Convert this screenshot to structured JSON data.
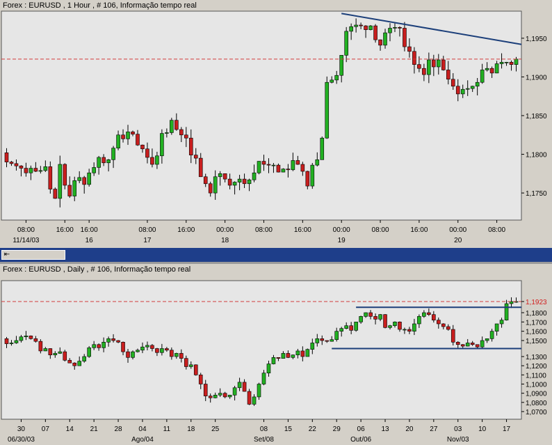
{
  "colors": {
    "background": "#e6e6e6",
    "bull": "#22b022",
    "bear": "#c81e1e",
    "price_line": "#d23c3c",
    "trendline": "#1c3f7a",
    "scrollbar": "#1e3e8a"
  },
  "chart_data": [
    {
      "type": "candlestick",
      "title": "Forex : EURUSD , 1 Hour , # 106, Informação tempo real",
      "current_price": 1.1923,
      "current_price_label": "1,1923",
      "ylim": [
        1.1715,
        1.1985
      ],
      "y_ticks": [
        {
          "value": 1.195,
          "label": "1,1950"
        },
        {
          "value": 1.19,
          "label": "1,1900"
        },
        {
          "value": 1.185,
          "label": "1,1850"
        },
        {
          "value": 1.18,
          "label": "1,1800"
        },
        {
          "value": 1.175,
          "label": "1,1750"
        }
      ],
      "x_count": 106,
      "x_ticks": [
        {
          "index": 4,
          "time": "08:00",
          "date": "11/14/03"
        },
        {
          "index": 12,
          "time": "16:00",
          "date": ""
        },
        {
          "index": 17,
          "time": "16:00",
          "date": "16"
        },
        {
          "index": 29,
          "time": "08:00",
          "date": "17"
        },
        {
          "index": 37,
          "time": "16:00",
          "date": ""
        },
        {
          "index": 45,
          "time": "00:00",
          "date": "18"
        },
        {
          "index": 53,
          "time": "08:00",
          "date": ""
        },
        {
          "index": 61,
          "time": "16:00",
          "date": ""
        },
        {
          "index": 69,
          "time": "00:00",
          "date": "19"
        },
        {
          "index": 77,
          "time": "08:00",
          "date": ""
        },
        {
          "index": 85,
          "time": "16:00",
          "date": ""
        },
        {
          "index": 93,
          "time": "00:00",
          "date": "20"
        },
        {
          "index": 101,
          "time": "08:00",
          "date": ""
        }
      ],
      "close": [
        1.179,
        1.1788,
        1.1785,
        1.1782,
        1.1776,
        1.1782,
        1.1778,
        1.1779,
        1.1784,
        1.1755,
        1.1743,
        1.1787,
        1.176,
        1.1746,
        1.1766,
        1.177,
        1.1761,
        1.1776,
        1.1783,
        1.1796,
        1.1789,
        1.1793,
        1.1808,
        1.1825,
        1.182,
        1.1829,
        1.1826,
        1.1812,
        1.1807,
        1.1796,
        1.1787,
        1.1798,
        1.1827,
        1.1828,
        1.1844,
        1.1832,
        1.1825,
        1.1821,
        1.1799,
        1.1795,
        1.1771,
        1.1762,
        1.175,
        1.1771,
        1.1775,
        1.1768,
        1.176,
        1.1764,
        1.1768,
        1.1762,
        1.1767,
        1.1776,
        1.1791,
        1.1787,
        1.1786,
        1.1786,
        1.1777,
        1.1781,
        1.178,
        1.1792,
        1.1787,
        1.1778,
        1.1759,
        1.1786,
        1.1793,
        1.1821,
        1.1893,
        1.1896,
        1.1902,
        1.1928,
        1.1959,
        1.1965,
        1.1967,
        1.1966,
        1.1961,
        1.1966,
        1.1948,
        1.1941,
        1.1957,
        1.1963,
        1.1964,
        1.1963,
        1.1939,
        1.1933,
        1.1916,
        1.1911,
        1.1903,
        1.1922,
        1.1913,
        1.1922,
        1.1909,
        1.1897,
        1.1888,
        1.1878,
        1.1884,
        1.1885,
        1.1888,
        1.1893,
        1.1909,
        1.1911,
        1.1905,
        1.1917,
        1.1919,
        1.1919,
        1.1916,
        1.1923
      ]
    },
    {
      "type": "candlestick",
      "title": "Forex : EURUSD , Daily , # 106, Informação tempo real",
      "current_price": 1.1923,
      "current_price_label": "1,1923",
      "y_ticks": [
        {
          "value": 1.1923,
          "label": "1,1923"
        },
        {
          "value": 1.18,
          "label": "1,1800"
        },
        {
          "value": 1.17,
          "label": "1,1700"
        },
        {
          "value": 1.16,
          "label": "1,1600"
        },
        {
          "value": 1.15,
          "label": "1,1500"
        },
        {
          "value": 1.13,
          "label": "1,1300"
        },
        {
          "value": 1.12,
          "label": "1,1200"
        },
        {
          "value": 1.11,
          "label": "1,1100"
        },
        {
          "value": 1.1,
          "label": "1,1000"
        },
        {
          "value": 1.09,
          "label": "1,0900"
        },
        {
          "value": 1.08,
          "label": "1,0800"
        },
        {
          "value": 1.07,
          "label": "1,0700"
        }
      ],
      "x_count": 106,
      "x_ticks": [
        {
          "index": 3,
          "day": "30",
          "month": "06/30/03"
        },
        {
          "index": 8,
          "day": "07",
          "month": ""
        },
        {
          "index": 13,
          "day": "14",
          "month": ""
        },
        {
          "index": 18,
          "day": "21",
          "month": ""
        },
        {
          "index": 23,
          "day": "28",
          "month": ""
        },
        {
          "index": 28,
          "day": "04",
          "month": "Ago/04"
        },
        {
          "index": 33,
          "day": "11",
          "month": ""
        },
        {
          "index": 38,
          "day": "18",
          "month": ""
        },
        {
          "index": 43,
          "day": "25",
          "month": ""
        },
        {
          "index": 53,
          "day": "08",
          "month": "Set/08"
        },
        {
          "index": 58,
          "day": "15",
          "month": ""
        },
        {
          "index": 63,
          "day": "22",
          "month": ""
        },
        {
          "index": 68,
          "day": "29",
          "month": ""
        },
        {
          "index": 73,
          "day": "06",
          "month": "Out/06"
        },
        {
          "index": 78,
          "day": "13",
          "month": ""
        },
        {
          "index": 83,
          "day": "20",
          "month": ""
        },
        {
          "index": 88,
          "day": "27",
          "month": ""
        },
        {
          "index": 93,
          "day": "03",
          "month": "Nov/03"
        },
        {
          "index": 98,
          "day": "10",
          "month": ""
        },
        {
          "index": 103,
          "day": "17",
          "month": ""
        }
      ],
      "close": [
        1.146,
        1.147,
        1.15,
        1.154,
        1.155,
        1.152,
        1.149,
        1.137,
        1.14,
        1.132,
        1.134,
        1.136,
        1.126,
        1.123,
        1.12,
        1.125,
        1.13,
        1.141,
        1.145,
        1.141,
        1.148,
        1.152,
        1.15,
        1.148,
        1.136,
        1.129,
        1.136,
        1.138,
        1.142,
        1.144,
        1.14,
        1.135,
        1.14,
        1.138,
        1.13,
        1.134,
        1.128,
        1.119,
        1.121,
        1.11,
        1.1,
        1.087,
        1.085,
        1.088,
        1.09,
        1.086,
        1.088,
        1.096,
        1.102,
        1.092,
        1.078,
        1.086,
        1.1,
        1.112,
        1.122,
        1.129,
        1.128,
        1.134,
        1.129,
        1.132,
        1.137,
        1.13,
        1.139,
        1.147,
        1.152,
        1.15,
        1.149,
        1.151,
        1.16,
        1.163,
        1.166,
        1.161,
        1.17,
        1.176,
        1.18,
        1.176,
        1.173,
        1.178,
        1.164,
        1.166,
        1.17,
        1.162,
        1.162,
        1.16,
        1.168,
        1.176,
        1.18,
        1.178,
        1.172,
        1.168,
        1.165,
        1.162,
        1.148,
        1.145,
        1.143,
        1.147,
        1.145,
        1.142,
        1.15,
        1.152,
        1.16,
        1.168,
        1.172,
        1.19,
        1.1923,
        1.1923
      ]
    }
  ]
}
